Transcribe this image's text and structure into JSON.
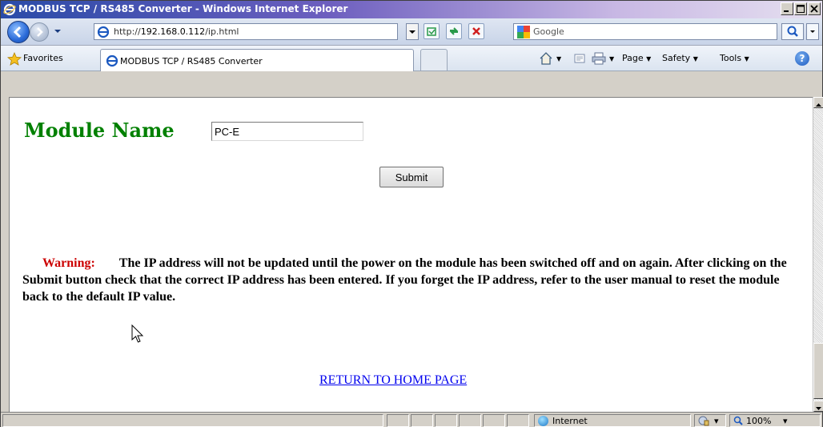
{
  "window": {
    "title": "MODBUS TCP / RS485 Converter - Windows Internet Explorer"
  },
  "address_bar": {
    "url_prefix": "http://",
    "url_host": "192.168.0.112",
    "url_path": "/ip.html",
    "search_placeholder": "Google"
  },
  "favorites_bar": {
    "favorites_label": "Favorites",
    "tab_label": "MODBUS TCP / RS485 Converter"
  },
  "command_bar": {
    "page_label": "Page",
    "safety_label": "Safety",
    "tools_label": "Tools",
    "help_glyph": "?"
  },
  "content": {
    "module_name_label": "Module Name",
    "module_name_value": "PC-E",
    "submit_label": "Submit",
    "warning_label": "Warning:",
    "warning_text": "The IP address will not be updated until the power on the module has been switched off and on again. After clicking on the Submit button check that the correct IP address has been entered. If you forget the IP address, refer to the user manual to reset the module back to the default IP value.",
    "home_link": "RETURN TO HOME PAGE"
  },
  "status_bar": {
    "zone_label": "Internet",
    "zoom_label": "100%"
  },
  "colors": {
    "module_name": "#008000",
    "warning_label": "#cc0000",
    "link": "#0000ee"
  }
}
